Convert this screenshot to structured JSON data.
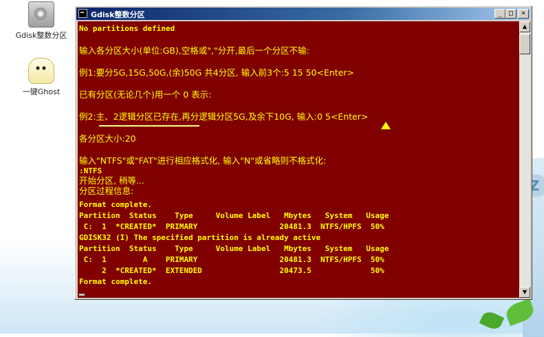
{
  "desktop": {
    "icons": [
      {
        "label": "Gdisk整数分区",
        "icon": "hard-disk-icon"
      },
      {
        "label": "一键Ghost",
        "icon": "ghost-icon"
      }
    ],
    "background_text": "Z"
  },
  "window": {
    "title": "Gdisk整数分区",
    "buttons": {
      "minimize": "_",
      "maximize": "□",
      "close": "×"
    }
  },
  "console": {
    "lines": [
      "No partitions defined",
      "输入各分区大小(单位:GB),空格或\",\"分开,最后一个分区不输:",
      "例1:要分5G,15G,50G,(余)50G 共4分区, 输入前3个:5 15 50<Enter>",
      "已有分区(无论几个)用一个 0 表示:",
      "例2:主、2逻辑分区已存在,再分逻辑分区5G,及余下10G, 输入:0 5<Enter>",
      "各分区大小:20",
      "输入\"NTFS\"或\"FAT\"进行相应格式化, 输入\"N\"或省略则不格式化:",
      ":NTFS",
      "开始分区, 稍等...",
      "分区过程信息:",
      "Format complete.",
      "Partition  Status    Type     Volume Label   Mbytes   System   Usage",
      " C:  1  *CREATED*  PRIMARY                  20481.3  NTFS/HPFS  50%",
      "GDISK32 (I) The specified partition is already active",
      "Partition  Status    Type     Volume Label   Mbytes   System   Usage",
      " C:  1        A    PRIMARY                  20481.3  NTFS/HPFS  50%",
      "     2  *CREATED*  EXTENDED                 20473.5             50%",
      "Format complete."
    ]
  },
  "colors": {
    "console_bg": "#800000",
    "console_text": "#ffff00",
    "titlebar_start": "#0a246a",
    "titlebar_end": "#a6caf0"
  }
}
